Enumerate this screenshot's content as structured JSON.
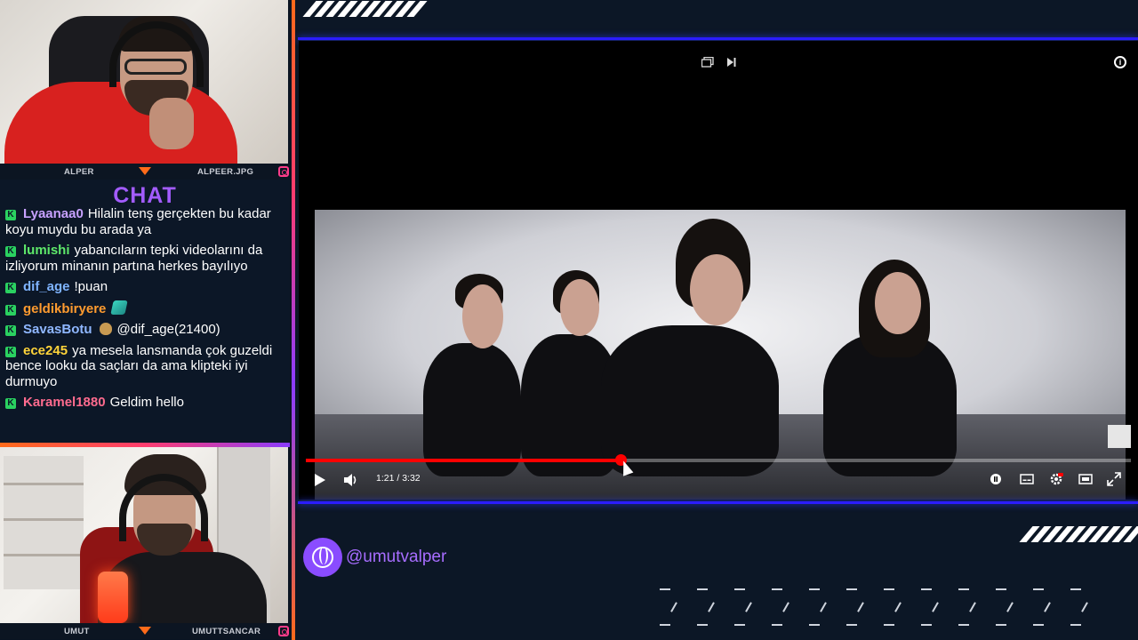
{
  "webcams": {
    "top": {
      "name_left": "ALPER",
      "name_right": "ALPEER.JPG"
    },
    "bottom": {
      "name_left": "UMUT",
      "name_right": "UMUTTSANCAR"
    }
  },
  "chat": {
    "title": "CHAT",
    "messages": [
      {
        "user": "Lyaanaa0",
        "color": "#c7a1ff",
        "text": "Hilalin tenş gerçekten bu kadar koyu muydu bu arada ya"
      },
      {
        "user": "lumishi",
        "color": "#5ee86a",
        "text": "yabancıların tepki videolarını da izliyorum minanın partına herkes bayılıyo"
      },
      {
        "user": "dif_age",
        "color": "#7fb4ff",
        "text": "!puan"
      },
      {
        "user": "geldikbiryere",
        "color": "#ff9b2f",
        "text": ""
      },
      {
        "user": "SavasBotu",
        "color": "#8fb7ff",
        "text": "@dif_age(21400)"
      },
      {
        "user": "ece245",
        "color": "#ffd43a",
        "text": "ya mesela lansmanda çok guzeldi bence looku da saçları da ama klipteki iyi durmuyo"
      },
      {
        "user": "Karamel1880",
        "color": "#ff6b8e",
        "text": "Geldim hello"
      }
    ],
    "badge_glyph": "K"
  },
  "player": {
    "time_display": "1:21 / 3:32",
    "progress_fraction": 0.382,
    "info_glyph": "i"
  },
  "profile": {
    "handle": "@umutvalper"
  },
  "colors": {
    "accent_purple": "#8a4cff",
    "progress_red": "#ff0000",
    "frame_blue": "#2b1cff"
  }
}
